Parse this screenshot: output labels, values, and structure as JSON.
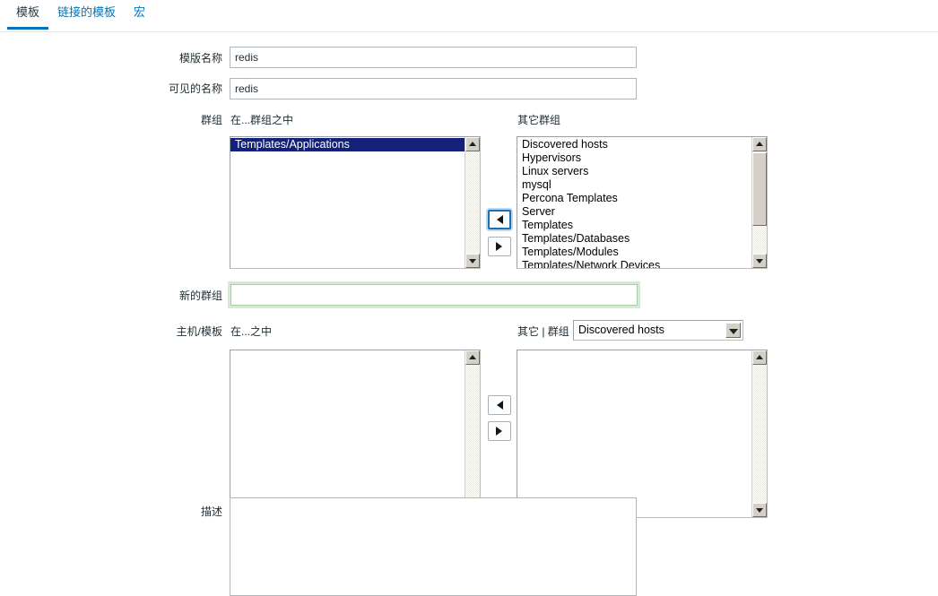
{
  "tabs": [
    {
      "label": "模板",
      "active": true
    },
    {
      "label": "链接的模板",
      "active": false
    },
    {
      "label": "宏",
      "active": false
    }
  ],
  "form": {
    "template_name": {
      "label": "模版名称",
      "value": "redis",
      "placeholder": ""
    },
    "visible_name": {
      "label": "可见的名称",
      "value": "redis",
      "placeholder": ""
    },
    "groups": {
      "label": "群组",
      "in_label": "在...群组之中",
      "other_label": "其它群组",
      "in_items": [
        "Templates/Applications"
      ],
      "in_selected": "Templates/Applications",
      "other_items": [
        "Discovered hosts",
        "Hypervisors",
        "Linux servers",
        "mysql",
        "Percona Templates",
        "Server",
        "Templates",
        "Templates/Databases",
        "Templates/Modules",
        "Templates/Network Devices"
      ],
      "move_left_icon": "triangle-left-icon",
      "move_right_icon": "triangle-right-icon"
    },
    "new_group": {
      "label": "新的群组",
      "value": "",
      "placeholder": ""
    },
    "host_templates": {
      "label": "主机/模板",
      "in_label": "在...之中",
      "other_label": "其它 | 群组",
      "in_items": [],
      "other_items": [],
      "group_select_value": "Discovered hosts",
      "move_left_icon": "triangle-left-icon",
      "move_right_icon": "triangle-right-icon"
    },
    "description": {
      "label": "描述",
      "value": "",
      "placeholder": ""
    }
  },
  "colors": {
    "accent": "#0275b8",
    "tab_link": "#0275b8",
    "selection_bg": "#14217a",
    "new_group_border": "#a8cfa8",
    "text": "#1f2c33"
  }
}
